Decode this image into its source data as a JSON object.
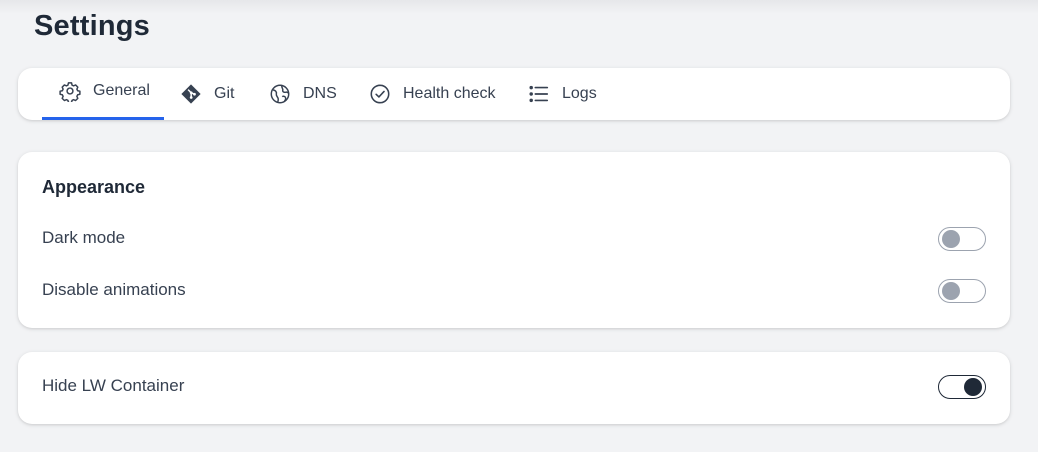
{
  "header": {
    "title": "Settings"
  },
  "tabs": [
    {
      "label": "General",
      "icon": "gear-icon",
      "active": true
    },
    {
      "label": "Git",
      "icon": "git-icon",
      "active": false
    },
    {
      "label": "DNS",
      "icon": "globe-icon",
      "active": false
    },
    {
      "label": "Health check",
      "icon": "check-circle-icon",
      "active": false
    },
    {
      "label": "Logs",
      "icon": "list-icon",
      "active": false
    }
  ],
  "appearance": {
    "heading": "Appearance",
    "rows": [
      {
        "label": "Dark mode",
        "enabled": false
      },
      {
        "label": "Disable animations",
        "enabled": false
      }
    ]
  },
  "container": {
    "label": "Hide LW Container",
    "enabled": true
  },
  "colors": {
    "accent": "#2563eb",
    "background": "#f2f3f5",
    "toggle_off": "#9ca3af",
    "toggle_on": "#1f2937"
  }
}
